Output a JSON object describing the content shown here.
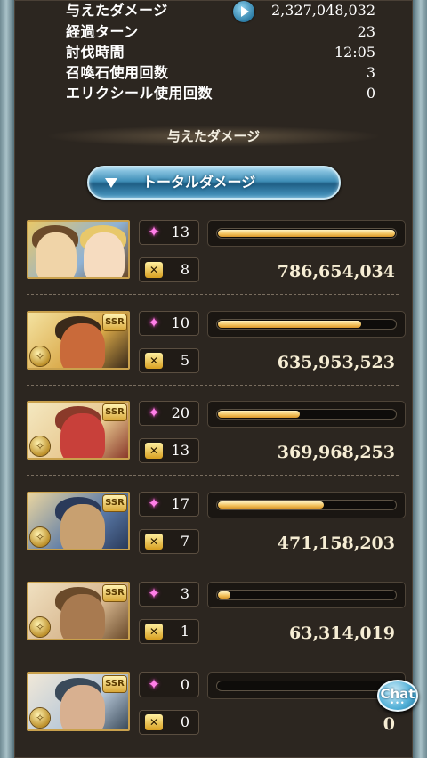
{
  "summary": {
    "rows": [
      {
        "label": "与えたダメージ",
        "value": "2,327,048,032"
      },
      {
        "label": "経過ターン",
        "value": "23"
      },
      {
        "label": "討伐時間",
        "value": "12:05"
      },
      {
        "label": "召喚石使用回数",
        "value": "3"
      },
      {
        "label": "エリクシール使用回数",
        "value": "0"
      }
    ]
  },
  "section_title": "与えたダメージ",
  "dropdown": {
    "selected": "トータルダメージ"
  },
  "colors": {
    "gauge_fill": "#f2c05a",
    "panel": "#2c2620",
    "dropdown": "#3f8fb8",
    "accent_gold": "#c9a14d"
  },
  "characters": [
    {
      "portrait": "main-character-duo",
      "ssr": false,
      "skill_count": "13",
      "chain_count": "8",
      "damage": "786,654,034",
      "gauge": 1.0
    },
    {
      "portrait": "light-character-1",
      "ssr": true,
      "ssr_label": "SSR",
      "skill_count": "10",
      "chain_count": "5",
      "damage": "635,953,523",
      "gauge": 0.81
    },
    {
      "portrait": "light-character-2",
      "ssr": true,
      "ssr_label": "SSR",
      "skill_count": "20",
      "chain_count": "13",
      "damage": "369,968,253",
      "gauge": 0.47
    },
    {
      "portrait": "light-character-3",
      "ssr": true,
      "ssr_label": "SSR",
      "skill_count": "17",
      "chain_count": "7",
      "damage": "471,158,203",
      "gauge": 0.6
    },
    {
      "portrait": "light-character-4",
      "ssr": true,
      "ssr_label": "SSR",
      "skill_count": "3",
      "chain_count": "1",
      "damage": "63,314,019",
      "gauge": 0.08
    },
    {
      "portrait": "light-character-5",
      "ssr": true,
      "ssr_label": "SSR",
      "skill_count": "0",
      "chain_count": "0",
      "damage": "0",
      "gauge": 0.0
    }
  ],
  "chat": {
    "label": "Chat",
    "dots": "•••"
  },
  "icons": {
    "skill": "sparkle-icon",
    "chain": "chain-burst-icon",
    "play": "play-icon",
    "dropdown": "triangle-down-icon"
  }
}
